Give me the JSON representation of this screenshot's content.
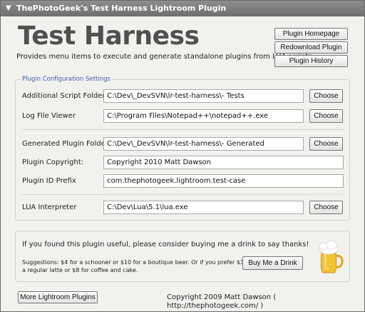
{
  "window": {
    "title": "ThePhotoGeek's Test Harness Lightroom Plugin",
    "collapse_glyph": "▼"
  },
  "header": {
    "heading": "Test Harness",
    "description": "Provides menu items to execute and generate standalone plugins from LUA scripts."
  },
  "top_buttons": {
    "homepage": "Plugin Homepage",
    "redownload": "Redownload Plugin",
    "history": "Plugin History"
  },
  "settings": {
    "legend": "Plugin Configuration Settings",
    "choose_label": "Choose",
    "rows": {
      "script_folder": {
        "label": "Additional Script Folder",
        "value": "C:\\Dev\\_DevSVN\\lr-test-harness\\- Tests"
      },
      "log_viewer": {
        "label": "Log File Viewer",
        "value": "C:\\Program Files\\Notepad++\\notepad++.exe"
      },
      "generated_folder": {
        "label": "Generated Plugin Folder",
        "value": "C:\\Dev\\_DevSVN\\lr-test-harness\\- Generated"
      },
      "copyright": {
        "label": "Plugin Copyright:",
        "value": "Copyright 2010 Matt Dawson"
      },
      "id_prefix": {
        "label": "Plugin ID Prefix",
        "value": "com.thephotogeek.lightroom.test-case"
      },
      "lua": {
        "label": "LUA Interpreter",
        "value": "C:\\Dev\\Lua\\5.1\\lua.exe"
      }
    }
  },
  "donate": {
    "message": "If you found this plugin useful, please consider buying me a drink to say thanks!",
    "suggestion_line1": "Suggestions: $4 for a schooner or $10 for a boutique beer.  Or if you prefer $3 for",
    "suggestion_line2": "a regular latte or $8 for coffee and cake.",
    "button": "Buy Me a Drink",
    "icon": "beer-mug-icon"
  },
  "footer": {
    "more_plugins": "More Lightroom Plugins",
    "copyright": "Copyright 2009 Matt Dawson  ( http://thephotogeek.com/ )"
  },
  "colors": {
    "titlebar": "#7a7a7a",
    "legend": "#3b5fb4",
    "heading": "#505050",
    "beer": "#f2c230"
  }
}
